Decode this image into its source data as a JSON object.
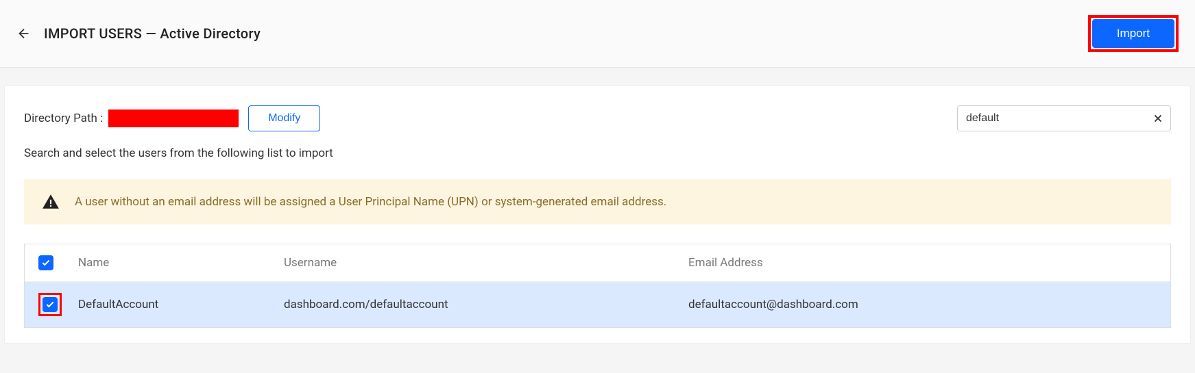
{
  "header": {
    "title": "IMPORT USERS — Active Directory",
    "import_label": "Import"
  },
  "path": {
    "label": "Directory Path :",
    "modify_label": "Modify"
  },
  "search": {
    "value": "default"
  },
  "instruction": "Search and select the users from the following list to import",
  "warning": {
    "text": "A user without an email address will be assigned a User Principal Name (UPN) or system-generated email address."
  },
  "table": {
    "headers": {
      "name": "Name",
      "username": "Username",
      "email": "Email Address"
    },
    "rows": [
      {
        "name": "DefaultAccount",
        "username": "dashboard.com/defaultaccount",
        "email": "defaultaccount@dashboard.com"
      }
    ]
  }
}
